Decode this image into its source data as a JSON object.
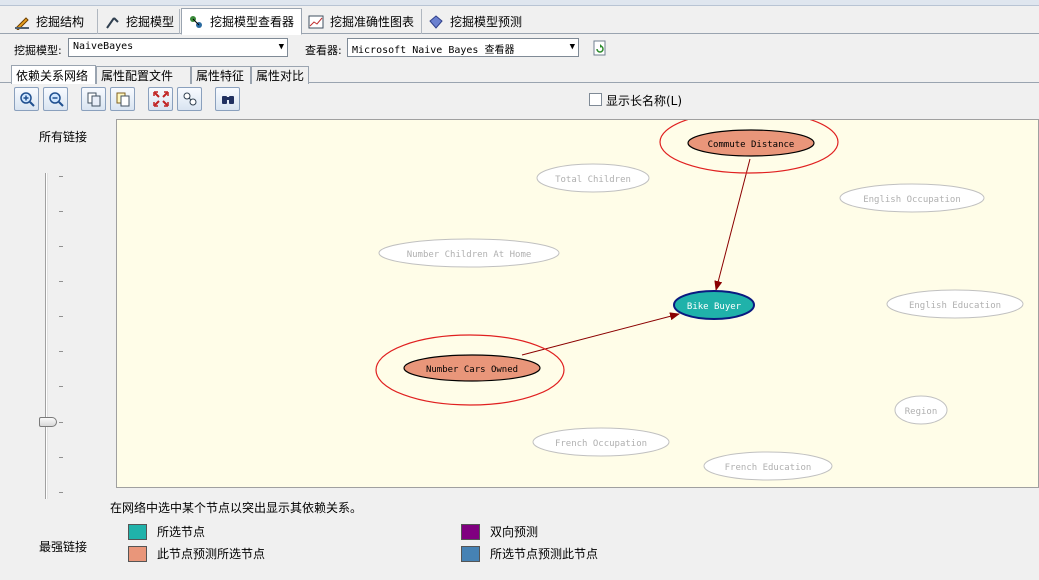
{
  "main_tabs": [
    {
      "label": "挖掘结构",
      "icon": "mining-structure-icon"
    },
    {
      "label": "挖掘模型",
      "icon": "mining-model-icon"
    },
    {
      "label": "挖掘模型查看器",
      "icon": "model-viewer-icon"
    },
    {
      "label": "挖掘准确性图表",
      "icon": "accuracy-chart-icon"
    },
    {
      "label": "挖掘模型预测",
      "icon": "prediction-icon"
    }
  ],
  "selectors": {
    "model_label": "挖掘模型:",
    "model_value": "NaiveBayes",
    "viewer_label": "查看器:",
    "viewer_value": "Microsoft Naive Bayes 查看器"
  },
  "sub_tabs": [
    "依赖关系网络",
    "属性配置文件",
    "属性特征",
    "属性对比"
  ],
  "toolbar": {
    "buttons": [
      "zoom-in-icon",
      "zoom-out-icon",
      "copy-graph-view-icon",
      "copy-entire-graph-icon",
      "fit-to-window-icon",
      "select-icon",
      "find-node-icon"
    ],
    "show_long_names_label": "显示长名称(L)"
  },
  "slider": {
    "top_label": "所有链接",
    "bottom_label": "最强链接"
  },
  "network": {
    "nodes": [
      {
        "id": "commute",
        "label": "Commute Distance",
        "state": "predicts"
      },
      {
        "id": "total_children",
        "label": "Total Children",
        "state": "inactive"
      },
      {
        "id": "eng_occupation",
        "label": "English Occupation",
        "state": "inactive"
      },
      {
        "id": "num_children_home",
        "label": "Number Children At Home",
        "state": "inactive"
      },
      {
        "id": "bike_buyer",
        "label": "Bike Buyer",
        "state": "selected"
      },
      {
        "id": "eng_education",
        "label": "English Education",
        "state": "inactive"
      },
      {
        "id": "cars",
        "label": "Number Cars Owned",
        "state": "predicts"
      },
      {
        "id": "region",
        "label": "Region",
        "state": "inactive"
      },
      {
        "id": "fr_occupation",
        "label": "French Occupation",
        "state": "inactive"
      },
      {
        "id": "fr_education",
        "label": "French Education",
        "state": "inactive"
      }
    ],
    "edges": [
      {
        "from": "commute",
        "to": "bike_buyer"
      },
      {
        "from": "cars",
        "to": "bike_buyer"
      }
    ]
  },
  "hint": "在网络中选中某个节点以突出显示其依赖关系。",
  "legend": [
    {
      "label": "所选节点",
      "color": "#20b2aa"
    },
    {
      "label": "双向预测",
      "color": "#800080"
    },
    {
      "label": "此节点预测所选节点",
      "color": "#e9967a"
    },
    {
      "label": "所选节点预测此节点",
      "color": "#4682b4"
    }
  ]
}
